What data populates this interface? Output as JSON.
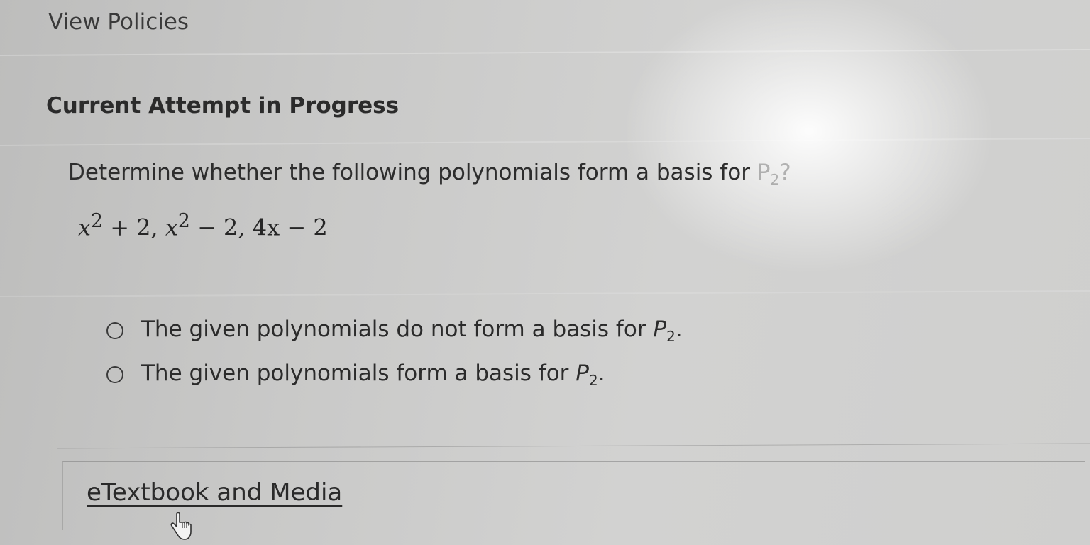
{
  "header": {
    "view_policies_label": "View Policies"
  },
  "attempt": {
    "heading": "Current Attempt in Progress"
  },
  "question": {
    "prompt_main": "Determine whether the following polynomials form a basis for ",
    "prompt_symbol": "P",
    "prompt_subscript": "2",
    "prompt_end": "?",
    "polynomials": {
      "p1_base": "x",
      "p1_exp": "2",
      "p1_rest": " + 2, ",
      "p2_base": "x",
      "p2_exp": "2",
      "p2_rest": " − 2, 4x − 2"
    }
  },
  "options": [
    {
      "text": "The given polynomials do not form a basis for ",
      "symbol": "P",
      "subscript": "2",
      "end": ".",
      "selected": false
    },
    {
      "text": "The given polynomials form a basis for ",
      "symbol": "P",
      "subscript": "2",
      "end": ".",
      "selected": false
    }
  ],
  "resources": {
    "etextbook_label": "eTextbook and Media"
  },
  "icons": {
    "cursor": "hand-pointer-icon"
  }
}
